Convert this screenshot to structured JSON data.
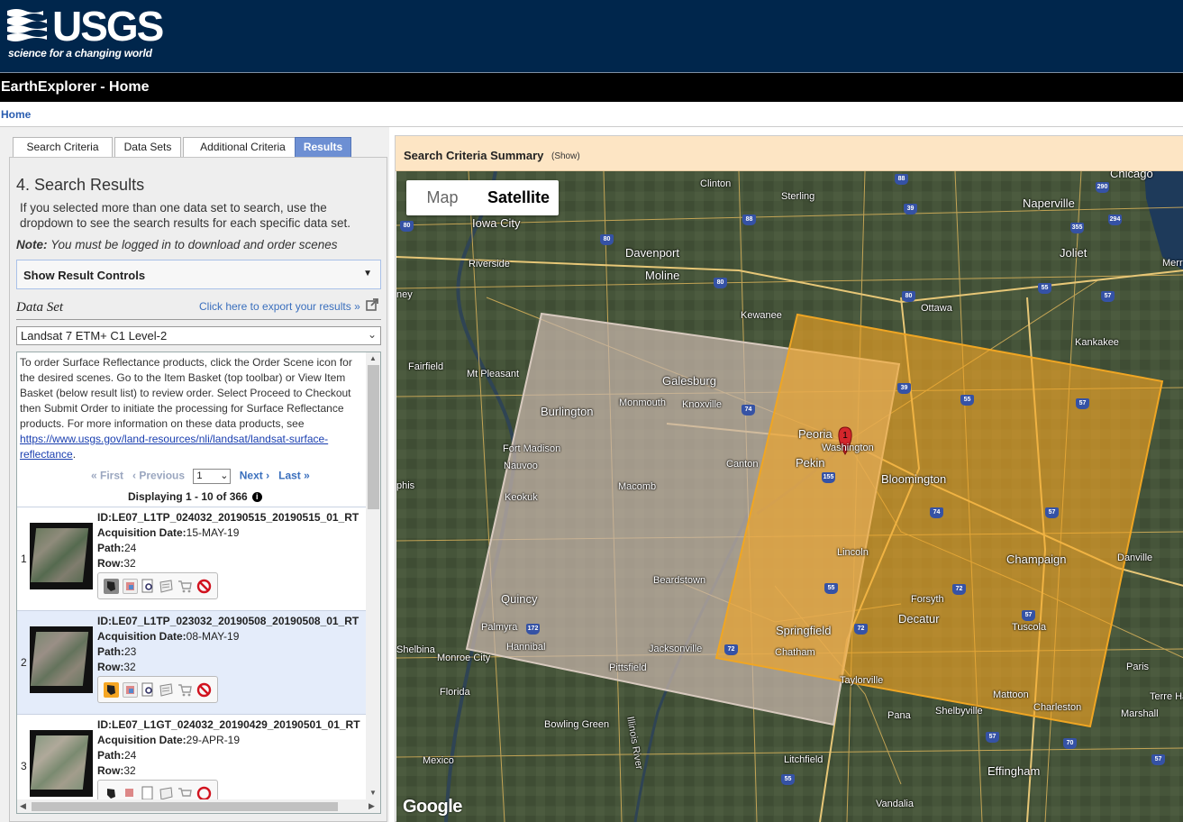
{
  "header": {
    "logo_word": "USGS",
    "tagline": "science for a changing world",
    "app_title": "EarthExplorer - Home",
    "breadcrumb": "Home"
  },
  "tabs": [
    {
      "label": "Search Criteria"
    },
    {
      "label": "Data Sets"
    },
    {
      "label": "Additional Criteria"
    },
    {
      "label": "Results",
      "active": true
    }
  ],
  "results_panel": {
    "title": "4. Search Results",
    "help": "If you selected more than one data set to search, use the dropdown to see the search results for each specific data set.",
    "note_label": "Note:",
    "note_text": "You must be logged in to download and order scenes",
    "controls_label": "Show Result Controls",
    "dataset_label": "Data Set",
    "export_link": "Click here to export your results »",
    "dataset_selected": "Landsat 7 ETM+ C1 Level-2",
    "info_text": "To order Surface Reflectance products, click the Order Scene icon for the desired scenes. Go to the Item Basket (top toolbar) or View Item Basket (below result list) to review order. Select Proceed to Checkout then Submit Order to initiate the processing for Surface Reflectance products. For more information on these data products, see",
    "info_link": "https://www.usgs.gov/land-resources/nli/landsat/landsat-surface-reflectance",
    "info_link_line1": "https://www.usgs.gov/land-resources/nli/landsat/landsat-surface-",
    "info_link_line2": "reflectance",
    "pager": {
      "first": "« First",
      "previous": "‹ Previous",
      "page": "1",
      "next": "Next ›",
      "last": "Last »"
    },
    "displaying": "Displaying 1 - 10 of 366",
    "labels": {
      "acq": "Acquisition Date:",
      "path": "Path:",
      "row": "Row:"
    },
    "results": [
      {
        "num": "1",
        "id": "ID:LE07_L1TP_024032_20190515_20190515_01_RT",
        "date": "15-MAY-19",
        "path": "24",
        "row": "32"
      },
      {
        "num": "2",
        "id": "ID:LE07_L1TP_023032_20190508_20190508_01_RT",
        "date": "08-MAY-19",
        "path": "23",
        "row": "32"
      },
      {
        "num": "3",
        "id": "ID:LE07_L1GT_024032_20190429_20190501_01_RT",
        "date": "29-APR-19",
        "path": "24",
        "row": "32"
      }
    ]
  },
  "map": {
    "summary_title": "Search Criteria Summary",
    "summary_toggle": "(Show)",
    "type_map": "Map",
    "type_satellite": "Satellite",
    "attribution": "Google",
    "pin_label": "1",
    "footprint_colors": {
      "selected": "#f5a623",
      "other": "#c9b7ac"
    },
    "cities": [
      {
        "name": "Chicago",
        "big": true
      },
      {
        "name": "Clinton"
      },
      {
        "name": "Sterling"
      },
      {
        "name": "Naperville",
        "big": true
      },
      {
        "name": "Iowa City",
        "big": true
      },
      {
        "name": "Davenport",
        "big": true
      },
      {
        "name": "Moline",
        "big": true
      },
      {
        "name": "Joliet",
        "big": true
      },
      {
        "name": "Riverside"
      },
      {
        "name": "Kewanee"
      },
      {
        "name": "Ottawa"
      },
      {
        "name": "Kankakee"
      },
      {
        "name": "Fairfield"
      },
      {
        "name": "Mt Pleasant"
      },
      {
        "name": "Galesburg",
        "big": true
      },
      {
        "name": "Burlington",
        "big": true
      },
      {
        "name": "Monmouth"
      },
      {
        "name": "Knoxville"
      },
      {
        "name": "Peoria",
        "big": true
      },
      {
        "name": "Washington"
      },
      {
        "name": "Pekin",
        "big": true
      },
      {
        "name": "Bloomington",
        "big": true
      },
      {
        "name": "Fort Madison"
      },
      {
        "name": "Nauvoo"
      },
      {
        "name": "Canton"
      },
      {
        "name": "Keokuk"
      },
      {
        "name": "Macomb"
      },
      {
        "name": "Lincoln"
      },
      {
        "name": "Champaign",
        "big": true
      },
      {
        "name": "Danville"
      },
      {
        "name": "Quincy",
        "big": true
      },
      {
        "name": "Beardstown"
      },
      {
        "name": "Forsyth"
      },
      {
        "name": "Decatur",
        "big": true
      },
      {
        "name": "Palmyra"
      },
      {
        "name": "Hannibal"
      },
      {
        "name": "Springfield",
        "big": true
      },
      {
        "name": "Tuscola"
      },
      {
        "name": "Jacksonville"
      },
      {
        "name": "Chatham"
      },
      {
        "name": "Shelbina"
      },
      {
        "name": "Monroe City"
      },
      {
        "name": "Pittsfield"
      },
      {
        "name": "Taylorville"
      },
      {
        "name": "Paris"
      },
      {
        "name": "Florida"
      },
      {
        "name": "Mattoon"
      },
      {
        "name": "Terre Ha"
      },
      {
        "name": "Charleston"
      },
      {
        "name": "Pana"
      },
      {
        "name": "Shelbyville"
      },
      {
        "name": "Marshall"
      },
      {
        "name": "Bowling Green"
      },
      {
        "name": "Mexico"
      },
      {
        "name": "Litchfield"
      },
      {
        "name": "Effingham",
        "big": true
      },
      {
        "name": "Vandalia"
      },
      {
        "name": "Illinois River"
      },
      {
        "name": "Merr"
      },
      {
        "name": "phis"
      },
      {
        "name": "ney"
      }
    ],
    "highways": [
      "88",
      "80",
      "290",
      "39",
      "88",
      "355",
      "294",
      "80",
      "80",
      "55",
      "80",
      "57",
      "39",
      "55",
      "74",
      "57",
      "155",
      "74",
      "57",
      "55",
      "72",
      "72",
      "57",
      "172",
      "72",
      "57",
      "70",
      "55",
      "57"
    ]
  }
}
